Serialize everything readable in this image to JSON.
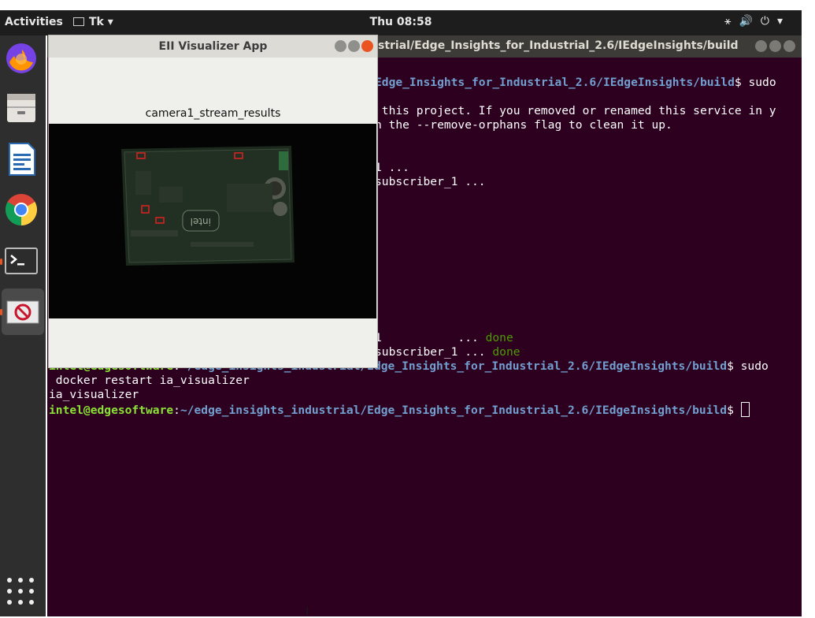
{
  "topbar": {
    "activities": "Activities",
    "app_menu": "Tk ▾",
    "clock": "Thu 08:58",
    "system_icons": [
      "network-icon",
      "volume-icon",
      "power-icon",
      "menu-arrow-icon"
    ]
  },
  "dock": {
    "items": [
      "firefox-icon",
      "files-icon",
      "writer-icon",
      "chrome-icon",
      "terminal-icon",
      "visualizer-icon"
    ],
    "show_apps": "show-applications-icon"
  },
  "terminal": {
    "title": "strial/Edge_Insights_for_Industrial_2.6/IEdgeInsights/build",
    "lines": [
      {
        "text": "",
        "extra": "Edge_Insights_for_Industrial_2.6/IEdgeInsights/build$ sudo",
        "extra_blue": "Edge_Insights_for_Industrial_2.6/IEdgeInsights/build",
        "tail": "$ sudo"
      },
      {
        "text": " this project. If you removed or renamed this service in y"
      },
      {
        "text": "n the --remove-orphans flag to clean it up."
      },
      {
        "text": "1 ..."
      },
      {
        "text": "subscriber_1 ..."
      },
      {
        "text": "1           ... ",
        "done": "done"
      },
      {
        "text": "subscriber_1 ... ",
        "done": "done"
      },
      {
        "prompt_user": "intel@edgesoftware",
        "prompt_path": "~/edge_insights_industrial/Edge_Insights_for_Industrial_2.6/IEdgeInsights/build",
        "tail": "$ sudo"
      },
      {
        "text": " docker restart ia_visualizer"
      },
      {
        "text": "ia_visualizer"
      },
      {
        "prompt_user": "intel@edgesoftware",
        "prompt_path": "~/edge_insights_industrial/Edge_Insights_for_Industrial_2.6/IEdgeInsights/build",
        "tail": "$ "
      }
    ]
  },
  "visualizer": {
    "title": "EII Visualizer App",
    "stream_label": "camera1_stream_results"
  },
  "colors": {
    "terminal_bg": "#2c001e",
    "prompt_green": "#8ae234",
    "path_blue": "#729fcf",
    "done_green": "#4e9a06",
    "ubuntu_orange": "#e95420"
  }
}
